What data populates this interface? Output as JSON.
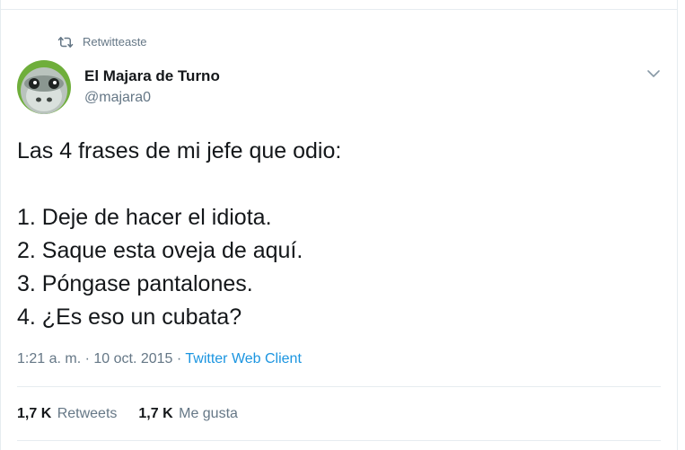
{
  "retweet_context": {
    "icon": "retweet-icon",
    "label": "Retwitteaste"
  },
  "author": {
    "display_name": "El Majara de Turno",
    "handle": "@majara0",
    "avatar_icon": "sheep-avatar"
  },
  "menu": {
    "icon": "chevron-down-icon"
  },
  "tweet": {
    "lines": [
      "Las 4 frases de mi jefe que odio:",
      "",
      "1. Deje de hacer el idiota.",
      "2. Saque esta oveja de aquí.",
      "3. Póngase pantalones.",
      "4. ¿Es eso un cubata?"
    ]
  },
  "meta": {
    "timestamp": "1:21 a. m. · 10 oct. 2015 · ",
    "source": "Twitter Web Client"
  },
  "stats": {
    "retweets_count": "1,7 K",
    "retweets_label": "Retweets",
    "likes_count": "1,7 K",
    "likes_label": "Me gusta"
  },
  "colors": {
    "text": "#14171a",
    "secondary": "#657786",
    "link": "#1b95e0",
    "border": "#e6ecf0"
  }
}
